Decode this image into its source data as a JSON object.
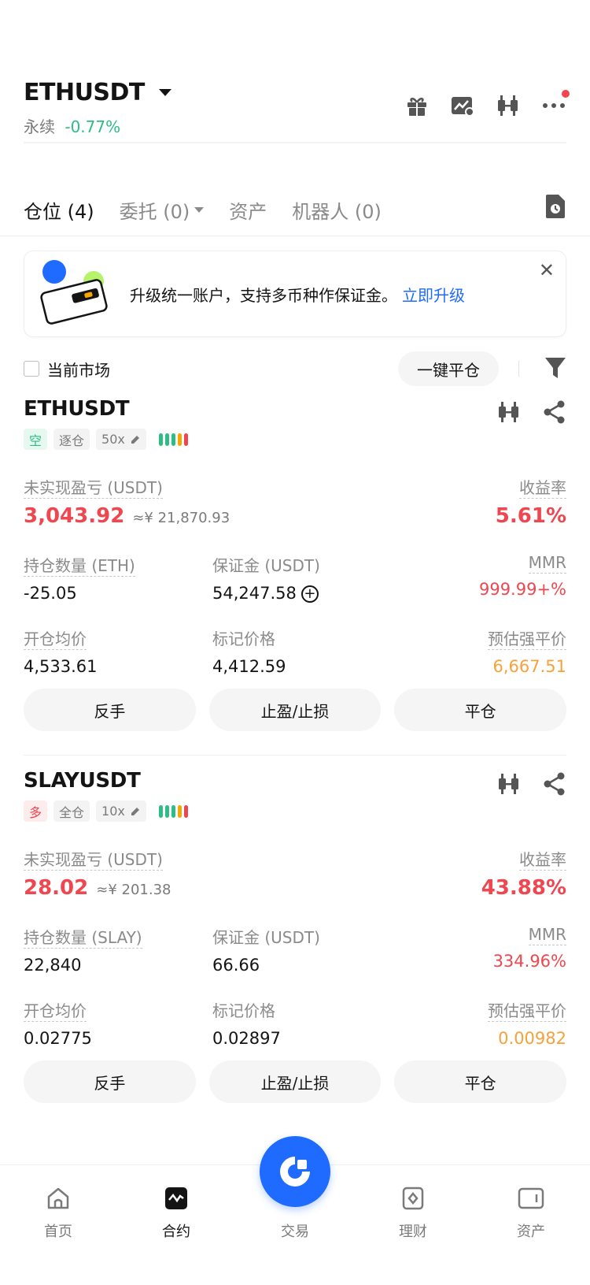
{
  "header": {
    "symbol": "ETHUSDT",
    "contract_type": "永续",
    "change": "-0.77%",
    "icons": [
      "gift-icon",
      "chart-settings-icon",
      "candlestick-icon",
      "more-icon"
    ]
  },
  "tabs": [
    {
      "label": "仓位 (4)"
    },
    {
      "label": "委托 (0)"
    },
    {
      "label": "资产"
    },
    {
      "label": "机器人 (0)"
    }
  ],
  "banner": {
    "text": "升级统一账户，支持多币种作保证金。",
    "link": "立即升级"
  },
  "filter": {
    "current_market": "当前市场",
    "close_all": "一键平仓"
  },
  "labels": {
    "unrealized_pnl": "未实现盈亏 (USDT)",
    "roe": "收益率",
    "margin": "保证金 (USDT)",
    "mmr": "MMR",
    "entry_price": "开仓均价",
    "mark_price": "标记价格",
    "liq_price": "预估强平价",
    "reverse": "反手",
    "tpsl": "止盈/止损",
    "close": "平仓"
  },
  "positions": [
    {
      "symbol": "ETHUSDT",
      "side": "空",
      "margin_mode": "逐仓",
      "leverage": "50x",
      "pnl": "3,043.92",
      "pnl_cny": "≈¥ 21,870.93",
      "roe": "5.61%",
      "qty_label": "持仓数量 (ETH)",
      "qty": "-25.05",
      "margin": "54,247.58",
      "mmr": "999.99+%",
      "entry": "4,533.61",
      "mark": "4,412.59",
      "liq": "6,667.51"
    },
    {
      "symbol": "SLAYUSDT",
      "side": "多",
      "margin_mode": "全仓",
      "leverage": "10x",
      "pnl": "28.02",
      "pnl_cny": "≈¥ 201.38",
      "roe": "43.88%",
      "qty_label": "持仓数量 (SLAY)",
      "qty": "22,840",
      "margin": "66.66",
      "mmr": "334.96%",
      "entry": "0.02775",
      "mark": "0.02897",
      "liq": "0.00982"
    }
  ],
  "nav": [
    {
      "label": "首页"
    },
    {
      "label": "合约"
    },
    {
      "label": "交易"
    },
    {
      "label": "理财"
    },
    {
      "label": "资产"
    }
  ],
  "colors": {
    "green": "#2ebd85",
    "red": "#f0464f",
    "orange": "#f7a13b",
    "blue": "#1f6bff"
  }
}
